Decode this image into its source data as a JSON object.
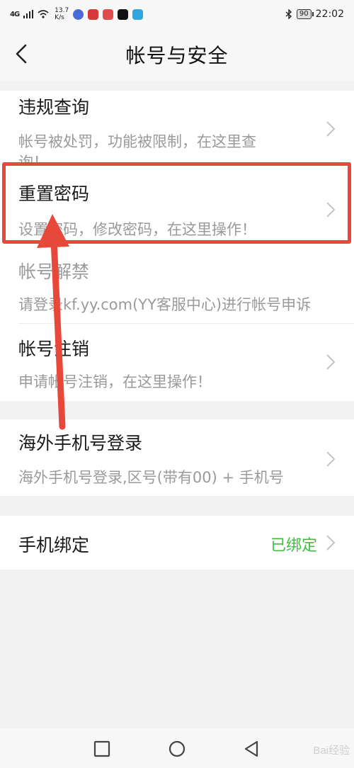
{
  "status_bar": {
    "signal": "4G",
    "net_speed_value": "13.7",
    "net_speed_unit": "K/s",
    "battery": "90",
    "time": "22:02"
  },
  "header": {
    "title": "帐号与安全"
  },
  "rows": {
    "violation": {
      "title": "违规查询",
      "subtitle": "帐号被处罚，功能被限制，在这里查",
      "subtitle_overflow": "询！"
    },
    "reset_password": {
      "title": "重置密码",
      "subtitle": "设置密码，修改密码，在这里操作！"
    },
    "unban": {
      "title": "帐号解禁",
      "subtitle": "请登录kf.yy.com(YY客服中心)进行帐号申诉"
    },
    "deactivate": {
      "title": "帐号注销",
      "subtitle": "申请帐号注销，在这里操作！"
    },
    "overseas_login": {
      "title": "海外手机号登录",
      "subtitle": "海外手机号登录,区号(带有00) + 手机号"
    },
    "phone_binding": {
      "title": "手机绑定",
      "status": "已绑定",
      "status_color": "#3fbf3f"
    }
  },
  "annotation": {
    "color": "#e8483a"
  },
  "watermark": "Bai经验"
}
